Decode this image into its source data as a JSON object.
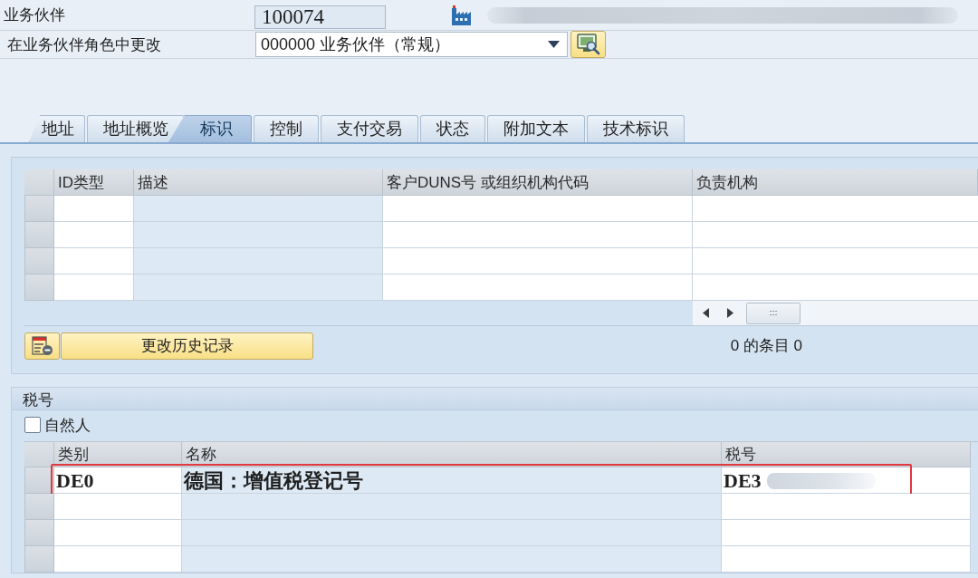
{
  "header": {
    "partner_label": "业务伙伴",
    "partner_number": "100074",
    "partner_name_redacted": true,
    "role_label": "在业务伙伴角色中更改",
    "role_value": "000000 业务伙伴（常规）"
  },
  "tabs": [
    {
      "label": "地址",
      "selected": false
    },
    {
      "label": "地址概览",
      "selected": false
    },
    {
      "label": "标识",
      "selected": true
    },
    {
      "label": "控制",
      "selected": false
    },
    {
      "label": "支付交易",
      "selected": false
    },
    {
      "label": "状态",
      "selected": false
    },
    {
      "label": "附加文本",
      "selected": false
    },
    {
      "label": "技术标识",
      "selected": false
    }
  ],
  "identification": {
    "table": {
      "columns": [
        {
          "label": "ID类型",
          "read_only": false
        },
        {
          "label": "描述",
          "read_only": true
        },
        {
          "label": "客户DUNS号 或组织机构代码",
          "read_only": false
        },
        {
          "label": "负责机构",
          "read_only": false
        }
      ],
      "rows": [
        {
          "selected": false
        },
        {
          "selected": false
        },
        {
          "selected": false
        },
        {
          "selected": false
        }
      ]
    },
    "history_button": "更改历史记录",
    "entry_count": "0 的条目 0"
  },
  "tax": {
    "title": "税号",
    "natural_person": {
      "label": "自然人",
      "checked": false
    },
    "table": {
      "columns": [
        {
          "label": "类别",
          "read_only": false
        },
        {
          "label": "名称",
          "read_only": true
        },
        {
          "label": "税号",
          "read_only": false
        }
      ],
      "rows": [
        {
          "selected": false,
          "highlighted": true,
          "cells": [
            "DE0",
            "德国：增值税登记号",
            "DE3"
          ],
          "redacted": true
        },
        {
          "selected": false,
          "highlighted": false
        },
        {
          "selected": false,
          "highlighted": false
        },
        {
          "selected": false,
          "highlighted": false
        }
      ]
    }
  }
}
